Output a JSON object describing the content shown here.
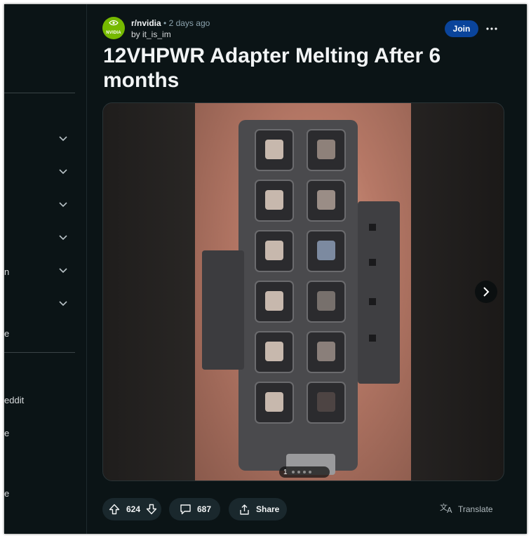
{
  "sidebar": {
    "text_fragments": [
      "n",
      "e",
      "eddit",
      "e",
      "e"
    ]
  },
  "post": {
    "subreddit": "r/nvidia",
    "separator": "•",
    "time_ago": "2 days ago",
    "author": "by it_is_im",
    "join_label": "Join",
    "more_label": "•••",
    "title": "12VHPWR Adapter Melting After 6 months",
    "avatar_text": "NVIDIA"
  },
  "media": {
    "current_page": "1",
    "total_dots": 4,
    "next_icon": "chevron-right-icon"
  },
  "actions": {
    "upvotes": "624",
    "comments": "687",
    "share_label": "Share",
    "translate_label": "Translate"
  },
  "colors": {
    "background": "#0b1416",
    "join_button": "#0a449b",
    "pill": "#1a282d",
    "nvidia_green": "#76b900"
  }
}
